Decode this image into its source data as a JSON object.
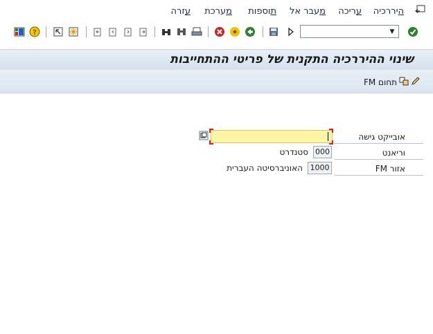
{
  "menubar": {
    "items": [
      {
        "label": "היררכיה",
        "mnemonic": "ה",
        "rest": "יררכיה"
      },
      {
        "label": "עריכה",
        "mnemonic": "ע",
        "rest": "ריכה"
      },
      {
        "label": "מעבר אל",
        "mnemonic": "מ",
        "rest": "עבר אל"
      },
      {
        "label": "תוספות",
        "mnemonic": "ת",
        "rest": "וספות"
      },
      {
        "label": "מערכת",
        "mnemonic": "מ",
        "rest": "ערכת"
      },
      {
        "label": "עזרה",
        "mnemonic": "ע",
        "rest": "זרה"
      }
    ]
  },
  "toolbar": {
    "command_field_value": ""
  },
  "title": "שינוי ההיררכיה התקנית של פריטי ההתחייבות",
  "app_toolbar": {
    "fm_area_button": "תחום FM"
  },
  "form": {
    "access_object_label": "אובייקט גישה",
    "access_object_value": "",
    "variant_label": "וריאנט",
    "variant_value": "000",
    "variant_desc": "סטנדרט",
    "fm_area_label": "אזור FM",
    "fm_area_value": "1000",
    "fm_area_desc": "האוניברסיטה העברית"
  },
  "colors": {
    "title_bar_bg": "#dae4ee",
    "required_field_bg": "#fff5a6",
    "required_marker": "#cc2222"
  }
}
